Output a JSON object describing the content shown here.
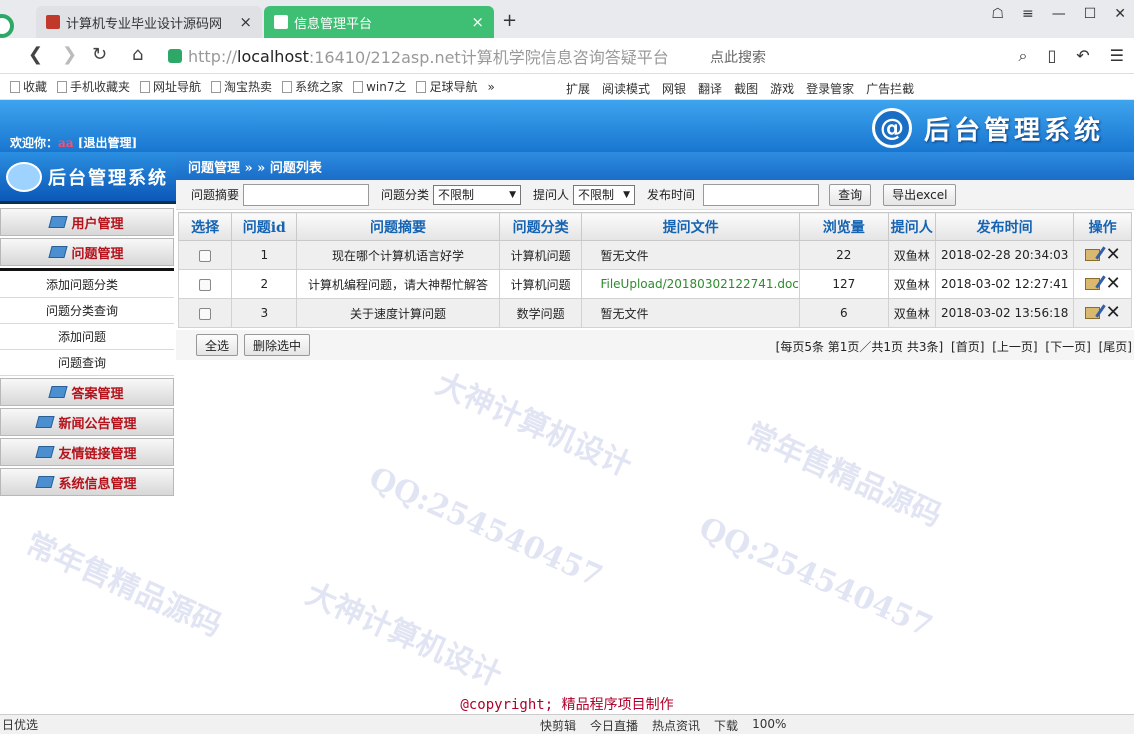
{
  "browser": {
    "tabs": [
      {
        "label": "计算机专业毕业设计源码网"
      },
      {
        "label": "信息管理平台"
      }
    ],
    "new_tab": "+",
    "url_scheme": "http://",
    "url_host": "localhost",
    "url_rest": ":16410/212asp.net计算机学院信息咨询答疑平台",
    "search_placeholder": "点此搜索",
    "bookmarks": [
      "收藏",
      "手机收藏夹",
      "网址导航",
      "淘宝热卖",
      "系统之家",
      "win7之",
      "足球导航",
      "»"
    ],
    "extensions": [
      "扩展",
      "阅读模式",
      "网银",
      "翻译",
      "截图",
      "游戏",
      "登录管家",
      "广告拦截"
    ]
  },
  "header": {
    "welcome_prefix": "欢迎你：",
    "username": "aa",
    "logout": "[退出管理]",
    "brand_title": "后台管理系统",
    "brand_icon": "@"
  },
  "sidebar": {
    "logo_text": "后台管理系统",
    "menus": [
      {
        "label": "用户管理"
      },
      {
        "label": "问题管理"
      },
      {
        "label": "答案管理"
      },
      {
        "label": "新闻公告管理"
      },
      {
        "label": "友情链接管理"
      },
      {
        "label": "系统信息管理"
      }
    ],
    "sub_items": [
      "添加问题分类",
      "问题分类查询",
      "添加问题",
      "问题查询"
    ]
  },
  "main": {
    "breadcrumb": "问题管理 » » 问题列表",
    "filter": {
      "summary_label": "问题摘要",
      "category_label": "问题分类",
      "category_value": "不限制",
      "asker_label": "提问人",
      "asker_value": "不限制",
      "time_label": "发布时间",
      "search_btn": "查询",
      "export_btn": "导出excel"
    },
    "columns": [
      "选择",
      "问题id",
      "问题摘要",
      "问题分类",
      "提问文件",
      "浏览量",
      "提问人",
      "发布时间",
      "操作"
    ],
    "rows": [
      {
        "id": "1",
        "summary": "现在哪个计算机语言好学",
        "category": "计算机问题",
        "file": "暂无文件",
        "views": "22",
        "asker": "双鱼林",
        "time": "2018-02-28 20:34:03"
      },
      {
        "id": "2",
        "summary": "计算机编程问题，请大神帮忙解答",
        "category": "计算机问题",
        "file": "FileUpload/20180302122741.doc",
        "views": "127",
        "asker": "双鱼林",
        "time": "2018-03-02 12:27:41"
      },
      {
        "id": "3",
        "summary": "关于速度计算问题",
        "category": "数学问题",
        "file": "暂无文件",
        "views": "6",
        "asker": "双鱼林",
        "time": "2018-03-02 13:56:18"
      }
    ],
    "select_all_btn": "全选",
    "delete_selected_btn": "删除选中",
    "pager": {
      "info": "[每页5条 第1页／共1页 共3条]",
      "first": "[首页]",
      "prev": "[上一页]",
      "next": "[下一页]",
      "last": "[尾页]"
    }
  },
  "footer": {
    "copyright": "@copyright; 精品程序项目制作"
  },
  "statusbar": {
    "left": "日优选",
    "items": [
      "快剪辑",
      "今日直播",
      "热点资讯",
      "下载",
      "100%"
    ]
  },
  "watermarks": [
    "常年售精品源码",
    "QQ:254540457",
    "大神计算机设计"
  ]
}
